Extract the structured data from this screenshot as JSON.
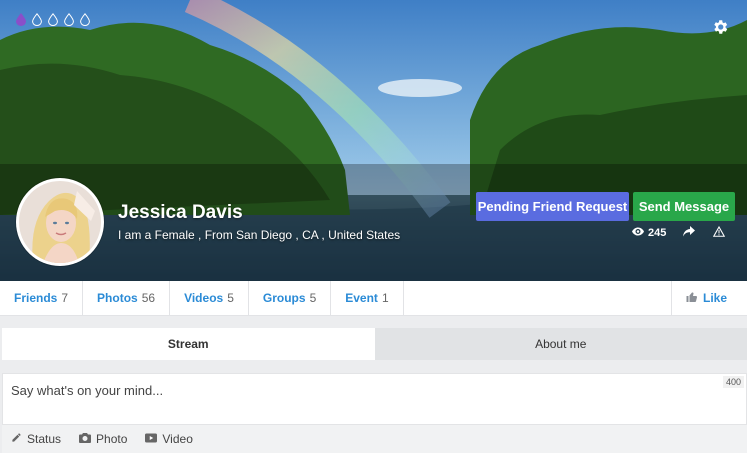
{
  "cover": {
    "indicators": [
      "drop-filled",
      "drop-empty",
      "drop-empty",
      "drop-empty",
      "drop-empty"
    ],
    "active_color": "#8a4fc9",
    "settings_icon": "gear-icon"
  },
  "profile": {
    "name": "Jessica Davis",
    "subtitle": "I am a Female , From San Diego , CA , United States"
  },
  "actions": {
    "pending_label": "Pending Friend Request",
    "message_label": "Send Message",
    "views": "245"
  },
  "stats": [
    {
      "label": "Friends",
      "count": "7"
    },
    {
      "label": "Photos",
      "count": "56"
    },
    {
      "label": "Videos",
      "count": "5"
    },
    {
      "label": "Groups",
      "count": "5"
    },
    {
      "label": "Event",
      "count": "1"
    }
  ],
  "like_label": "Like",
  "tabs": {
    "stream": "Stream",
    "about": "About me"
  },
  "composer": {
    "placeholder": "Say what's on your mind...",
    "char_limit": "400"
  },
  "post_types": {
    "status": "Status",
    "photo": "Photo",
    "video": "Video"
  },
  "colors": {
    "pending_button": "#5a6ce0",
    "message_button": "#29a74a",
    "link": "#2b8bd6"
  }
}
